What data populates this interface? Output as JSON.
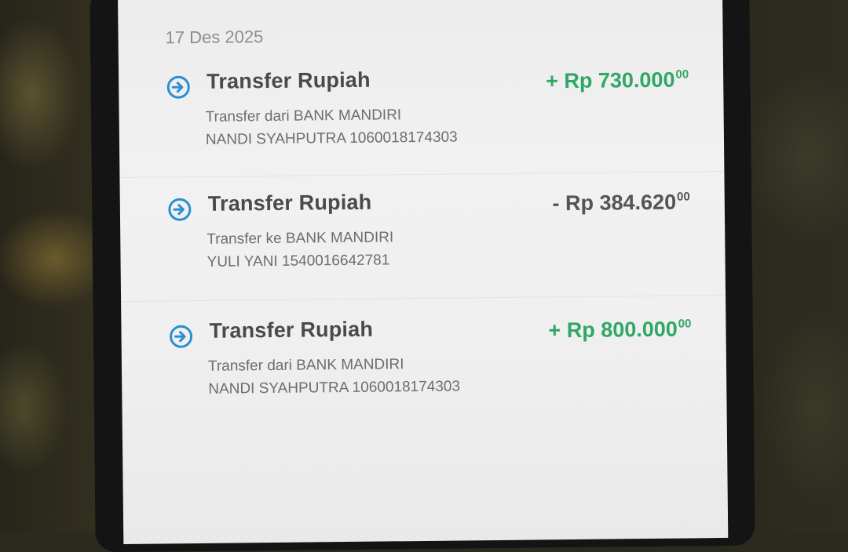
{
  "date_header": "17 Des 2025",
  "icon_color": "#2a8fd0",
  "transactions": [
    {
      "icon": "transfer-arrow-icon",
      "title": "Transfer Rupiah",
      "description_line1": "Transfer dari BANK MANDIRI",
      "description_line2": "NANDI SYAHPUTRA 1060018174303",
      "amount_main": "+ Rp 730.000",
      "amount_cents": "00",
      "direction": "in",
      "amount_color": "#2fa866"
    },
    {
      "icon": "transfer-arrow-icon",
      "title": "Transfer Rupiah",
      "description_line1": "Transfer ke BANK MANDIRI",
      "description_line2": "YULI YANI 1540016642781",
      "amount_main": "- Rp 384.620",
      "amount_cents": "00",
      "direction": "out",
      "amount_color": "#555555"
    },
    {
      "icon": "transfer-arrow-icon",
      "title": "Transfer Rupiah",
      "description_line1": "Transfer dari BANK MANDIRI",
      "description_line2": "NANDI SYAHPUTRA 1060018174303",
      "amount_main": "+ Rp 800.000",
      "amount_cents": "00",
      "direction": "in",
      "amount_color": "#2fa866"
    }
  ]
}
